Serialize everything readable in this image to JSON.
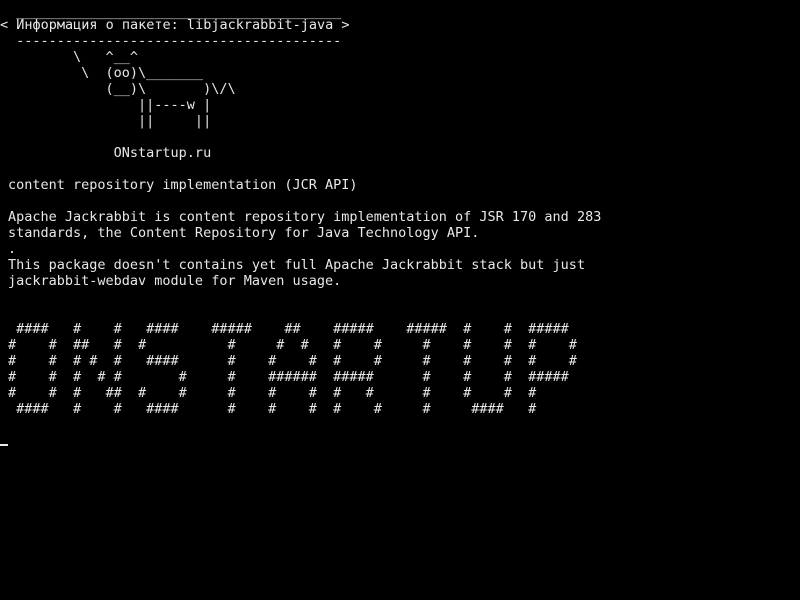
{
  "terminal": {
    "colors": {
      "background": "#000000",
      "foreground": "#e8e8e8"
    },
    "cowsay": {
      "top_border": " ________________________________________",
      "message": "< Информация о пакете: libjackrabbit-java >",
      "bottom_border": " ----------------------------------------",
      "cow_1": "        \\   ^__^",
      "cow_2": "         \\  (oo)\\_______",
      "cow_3": "            (__)\\       )\\/\\",
      "cow_4": "                ||----w |",
      "cow_5": "                ||     ||"
    },
    "site": "             ONstartup.ru",
    "summary": "content repository implementation (JCR API)",
    "description": {
      "line_1": "Apache Jackrabbit is content repository implementation of JSR 170 and 283",
      "line_2": "standards, the Content Repository for Java Technology API.",
      "line_3": ".",
      "line_4": "This package doesn't contains yet full Apache Jackrabbit stack but just",
      "line_5": "jackrabbit-webdav module for Maven usage."
    },
    "banner": {
      "row_1": " ####   #    #   ####    #####    ##    #####    #####  #    #  #####",
      "row_2": "#    #  ##   #  #          #     #  #   #    #     #    #    #  #    #",
      "row_3": "#    #  # #  #   ####      #    #    #  #    #     #    #    #  #    #",
      "row_4": "#    #  #  # #       #     #    ######  #####      #    #    #  #####",
      "row_5": "#    #  #   ##  #    #     #    #    #  #   #      #    #    #  #",
      "row_6": " ####   #    #   ####      #    #    #  #    #     #     ####   #"
    }
  }
}
